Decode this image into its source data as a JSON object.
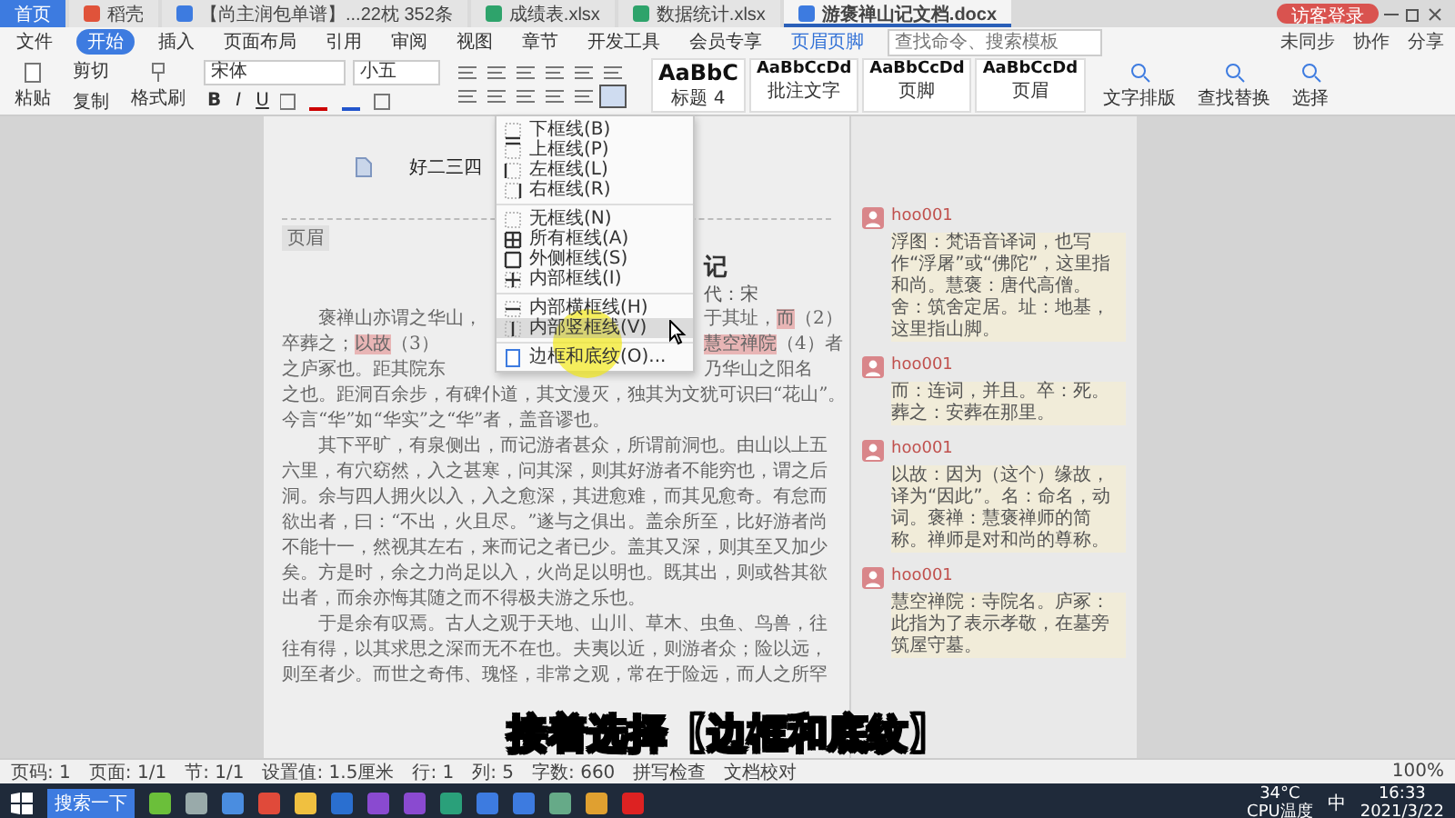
{
  "tabs": [
    {
      "label": "首页",
      "kind": "home",
      "selected": false
    },
    {
      "label": "稻壳",
      "kind": "app",
      "selected": false
    },
    {
      "label": "【尚主润包单谱】...22枕 352条",
      "kind": "doc",
      "selected": false
    },
    {
      "label": "成绩表.xlsx",
      "kind": "sheet",
      "selected": false
    },
    {
      "label": "数据统计.xlsx",
      "kind": "sheet",
      "selected": false
    },
    {
      "label": "游褒禅山记文档.docx",
      "kind": "doc",
      "selected": true
    }
  ],
  "login_button": "访客登录",
  "menu_tabs": [
    {
      "label": "文件",
      "kind": "file",
      "selected": false
    },
    {
      "label": "开始",
      "kind": "tab",
      "selected": true
    },
    {
      "label": "插入",
      "kind": "tab",
      "selected": false
    },
    {
      "label": "页面布局",
      "kind": "tab",
      "selected": false
    },
    {
      "label": "引用",
      "kind": "tab",
      "selected": false
    },
    {
      "label": "审阅",
      "kind": "tab",
      "selected": false
    },
    {
      "label": "视图",
      "kind": "tab",
      "selected": false
    },
    {
      "label": "章节",
      "kind": "tab",
      "selected": false
    },
    {
      "label": "开发工具",
      "kind": "tab",
      "selected": false
    },
    {
      "label": "会员专享",
      "kind": "tab",
      "selected": false
    },
    {
      "label": "页眉页脚",
      "kind": "context",
      "selected": false
    }
  ],
  "command_search": {
    "placeholder": "查找命令、搜索模板"
  },
  "cloud_actions": [
    "未同步",
    "协作",
    "分享"
  ],
  "ribbon": {
    "format_buttons": [
      "B",
      "I",
      "U"
    ],
    "paste": "粘贴",
    "cut": "剪切",
    "copy": "复制",
    "format_painter": "格式刷",
    "font_name": "宋体",
    "font_size": "小五",
    "styles": [
      {
        "sample": "AaBbC",
        "name": "标题 4"
      },
      {
        "sample": "AaBbCcDd",
        "name": "批注文字"
      },
      {
        "sample": "AaBbCcDd",
        "name": "页脚"
      },
      {
        "sample": "AaBbCcDd",
        "name": "页眉"
      }
    ],
    "tools": [
      "文字排版",
      "查找替换",
      "选择"
    ]
  },
  "border_menu": {
    "groups": [
      [
        {
          "label": "下框线(B)",
          "selected": false
        },
        {
          "label": "上框线(P)",
          "selected": false
        },
        {
          "label": "左框线(L)",
          "selected": false
        },
        {
          "label": "右框线(R)",
          "selected": false
        }
      ],
      [
        {
          "label": "无框线(N)",
          "selected": false
        },
        {
          "label": "所有框线(A)",
          "selected": false
        },
        {
          "label": "外侧框线(S)",
          "selected": false
        },
        {
          "label": "内部框线(I)",
          "selected": false
        }
      ],
      [
        {
          "label": "内部横框线(H)",
          "selected": false
        },
        {
          "label": "内部竖框线(V)",
          "selected": true
        }
      ],
      [
        {
          "label": "边框和底纹(O)...",
          "selected": false
        }
      ]
    ]
  },
  "document": {
    "header_text": "好二三四",
    "header_label": "页眉",
    "title": "记",
    "author": "代：宋",
    "lines": [
      {
        "indent": true,
        "segments": [
          {
            "text": "褒禅山亦谓之华山，",
            "highlighted": false
          }
        ],
        "after_menu": [
          {
            "text": "于其址，",
            "highlighted": false
          },
          {
            "text": "而",
            "highlighted": true
          },
          {
            "text": "（2）",
            "highlighted": false
          }
        ]
      },
      {
        "indent": false,
        "segments": [
          {
            "text": "卒葬之；",
            "highlighted": false
          },
          {
            "text": "以故",
            "highlighted": true
          },
          {
            "text": "（3）",
            "highlighted": false
          }
        ],
        "after_menu": [
          {
            "text": "慧空禅院",
            "highlighted": true
          },
          {
            "text": "（4）者",
            "highlighted": false
          }
        ]
      },
      {
        "indent": false,
        "segments": [
          {
            "text": "之庐冢也。距其院东",
            "highlighted": false
          }
        ],
        "after_menu": [
          {
            "text": "乃华山之阳名",
            "highlighted": false
          }
        ]
      },
      {
        "indent": false,
        "segments": [
          {
            "text": "之也。距洞百余步，有碑仆道，其文漫灭，独其为文犹可识曰“花山”。",
            "highlighted": false
          }
        ]
      },
      {
        "indent": false,
        "segments": [
          {
            "text": "今言“华”如“华实”之“华”者，盖音谬也。",
            "highlighted": false
          }
        ]
      },
      {
        "indent": true,
        "segments": [
          {
            "text": "其下平旷，有泉侧出，而记游者甚众，所谓前洞也。由山以上五",
            "highlighted": false
          }
        ]
      },
      {
        "indent": false,
        "segments": [
          {
            "text": "六里，有穴窈然，入之甚寒，问其深，则其好游者不能穷也，谓之后",
            "highlighted": false
          }
        ]
      },
      {
        "indent": false,
        "segments": [
          {
            "text": "洞。余与四人拥火以入，入之愈深，其进愈难，而其见愈奇。有怠而",
            "highlighted": false
          }
        ]
      },
      {
        "indent": false,
        "segments": [
          {
            "text": "欲出者，曰：“不出，火且尽。”遂与之俱出。盖余所至，比好游者尚",
            "highlighted": false
          }
        ]
      },
      {
        "indent": false,
        "segments": [
          {
            "text": "不能十一，然视其左右，来而记之者已少。盖其又深，则其至又加少",
            "highlighted": false
          }
        ]
      },
      {
        "indent": false,
        "segments": [
          {
            "text": "矣。方是时，余之力尚足以入，火尚足以明也。既其出，则或咎其欲",
            "highlighted": false
          }
        ]
      },
      {
        "indent": false,
        "segments": [
          {
            "text": "出者，而余亦悔其随之而不得极夫游之乐也。",
            "highlighted": false
          }
        ]
      },
      {
        "indent": true,
        "segments": [
          {
            "text": "于是余有叹焉。古人之观于天地、山川、草木、虫鱼、鸟兽，往",
            "highlighted": false
          }
        ]
      },
      {
        "indent": false,
        "segments": [
          {
            "text": "往有得，以其求思之深而无不在也。夫夷以近，则游者众；险以远，",
            "highlighted": false
          }
        ]
      },
      {
        "indent": false,
        "segments": [
          {
            "text": "则至者少。而世之奇伟、瑰怪，非常之观，常在于险远，而人之所罕",
            "highlighted": false
          }
        ]
      }
    ]
  },
  "comments": [
    {
      "author": "hoo001",
      "text": "浮图：梵语音译词，也写作“浮屠”或“佛陀”，这里指和尚。慧褒：唐代高僧。舍：筑舍定居。址：地基，这里指山脚。"
    },
    {
      "author": "hoo001",
      "text": "而：连词，并且。卒：死。葬之：安葬在那里。"
    },
    {
      "author": "hoo001",
      "text": "以故：因为（这个）缘故，译为“因此”。名：命名，动词。褒禅：慧褒禅师的简称。禅师是对和尚的尊称。"
    },
    {
      "author": "hoo001",
      "text": "慧空禅院：寺院名。庐冢：此指为了表示孝敬，在墓旁筑屋守墓。"
    }
  ],
  "caption": "接着选择【边框和底纹】",
  "status_bar": {
    "items": [
      "页码: 1",
      "页面: 1/1",
      "节: 1/1",
      "设置值: 1.5厘米",
      "行: 1",
      "列: 5",
      "字数: 660",
      "拼写检查",
      "文档校对"
    ],
    "zoom": "100%"
  },
  "taskbar": {
    "search_button": "搜索一下",
    "weather": "34°C",
    "weather_label": "CPU温度",
    "ime": "中",
    "time": "16:33",
    "date": "2021/3/22"
  }
}
